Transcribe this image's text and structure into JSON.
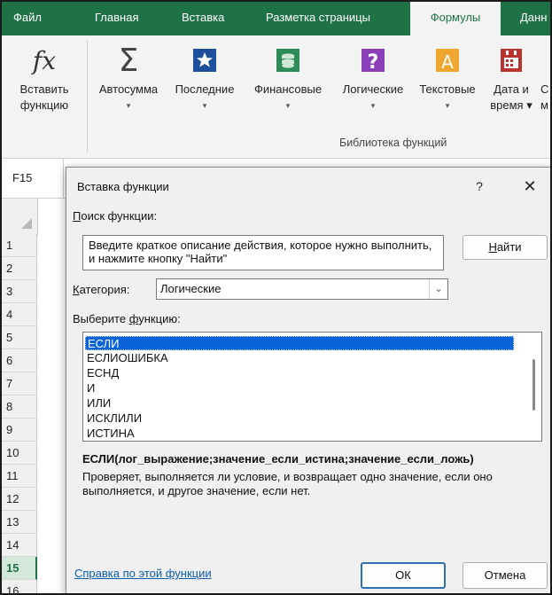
{
  "ribbon_tabs": [
    {
      "label": "Файл",
      "active": false
    },
    {
      "label": "Главная",
      "active": false
    },
    {
      "label": "Вставка",
      "active": false
    },
    {
      "label": "Разметка страницы",
      "active": false
    },
    {
      "label": "Формулы",
      "active": true
    },
    {
      "label": "Данн",
      "active": false
    }
  ],
  "ribbon": {
    "insert_function": {
      "line1": "Вставить",
      "line2": "функцию",
      "icon": "fx-icon"
    },
    "buttons": [
      {
        "line1": "Автосумма",
        "line2": "▾",
        "icon": "sigma-icon"
      },
      {
        "line1": "Последние",
        "line2": "▾",
        "icon": "star-icon"
      },
      {
        "line1": "Финансовые",
        "line2": "▾",
        "icon": "money-icon"
      },
      {
        "line1": "Логические",
        "line2": "▾",
        "icon": "question-icon"
      },
      {
        "line1": "Текстовые",
        "line2": "▾",
        "icon": "text-a-icon"
      },
      {
        "line1": "Дата и",
        "line2": "время ▾",
        "icon": "calendar-icon"
      },
      {
        "line1": "С",
        "line2": "м",
        "icon": "partial-icon"
      }
    ],
    "group_label": "Библиотека функций"
  },
  "name_box": "F15",
  "rows": [
    "1",
    "2",
    "3",
    "4",
    "5",
    "6",
    "7",
    "8",
    "9",
    "10",
    "11",
    "12",
    "13",
    "14",
    "15",
    "16"
  ],
  "selected_row": "15",
  "dialog": {
    "title": "Вставка функции",
    "help_glyph": "?",
    "close_glyph": "✕",
    "search_label_ul": "П",
    "search_label_rest": "оиск функции:",
    "search_text": "Введите краткое описание действия, которое нужно выполнить, и нажмите кнопку \"Найти\"",
    "find_ul": "Н",
    "find_rest": "айти",
    "category_label_ul": "К",
    "category_label_rest": "атегория:",
    "category_value": "Логические",
    "select_label_pre": "Выберите ",
    "select_label_ul": "ф",
    "select_label_rest": "ункцию:",
    "functions": [
      "ЕСЛИ",
      "ЕСЛИОШИБКА",
      "ЕСНД",
      "И",
      "ИЛИ",
      "ИСКЛИЛИ",
      "ИСТИНА"
    ],
    "selected_function": "ЕСЛИ",
    "syntax": "ЕСЛИ(лог_выражение;значение_если_истина;значение_если_ложь)",
    "description": "Проверяет, выполняется ли условие, и возвращает одно значение, если оно выполняется, и другое значение, если нет.",
    "help_link": "Справка по этой функции",
    "ok_label": "ОК",
    "cancel_label": "Отмена"
  },
  "colors": {
    "accent": "#1f7246",
    "selection": "#0a64d8",
    "link": "#0b5cad"
  }
}
